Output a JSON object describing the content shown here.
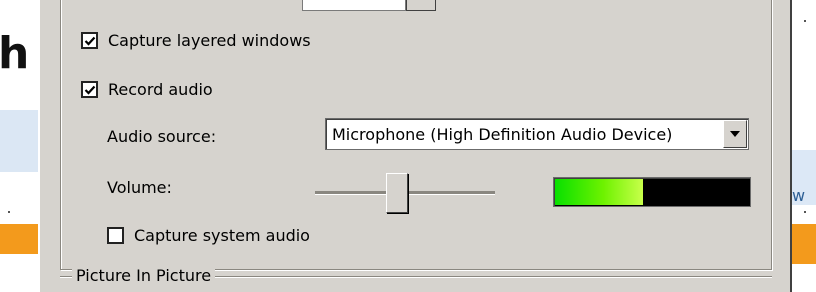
{
  "background": {
    "left_partial_text": "h",
    "right_partial_text": "w"
  },
  "options": {
    "capture_layered_windows": {
      "label": "Capture layered windows",
      "checked": true
    },
    "record_audio": {
      "label": "Record audio",
      "checked": true
    },
    "audio_source": {
      "label": "Audio source:",
      "value": "Microphone (High Definition Audio Device)"
    },
    "volume": {
      "label": "Volume:",
      "slider_level": 0.45,
      "meter_level": 0.46
    },
    "capture_system_audio": {
      "label": "Capture system audio",
      "checked": false
    }
  },
  "picture_in_picture": {
    "title": "Picture In Picture"
  },
  "icons": {
    "check": "checkmark-icon",
    "dropdown": "triangle-down-icon"
  },
  "colors": {
    "dialog_bg": "#d6d3ce",
    "meter_green": "#6ef200",
    "meter_bg": "#000000"
  }
}
